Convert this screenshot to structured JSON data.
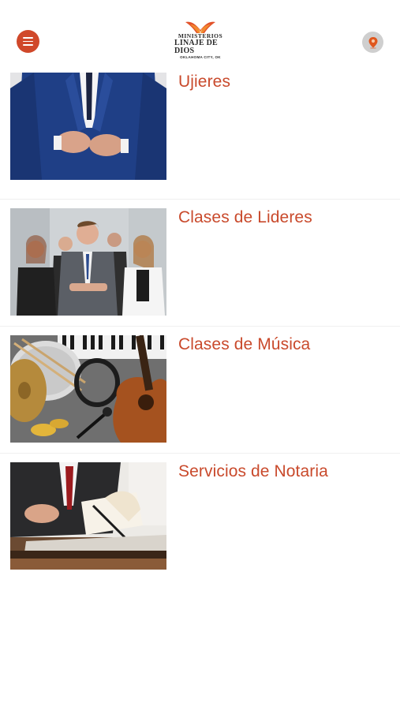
{
  "header": {
    "menu_icon": "hamburger-menu-icon",
    "logo": {
      "line1": "MINISTERIOS",
      "line2": "LINAJE DE DIOS",
      "line3": "OKLAHOMA CITY, OK"
    },
    "location_icon": "map-pin-icon"
  },
  "items": [
    {
      "title": "Ujieres",
      "image": "man-in-blue-suit"
    },
    {
      "title": "Clases de Lideres",
      "image": "business-team"
    },
    {
      "title": "Clases de Música",
      "image": "musical-instruments"
    },
    {
      "title": "Servicios de Notaria",
      "image": "notary-signing-document"
    }
  ],
  "colors": {
    "accent": "#d0482a",
    "title": "#c94a2c",
    "location_bg": "#cfcfcf"
  }
}
